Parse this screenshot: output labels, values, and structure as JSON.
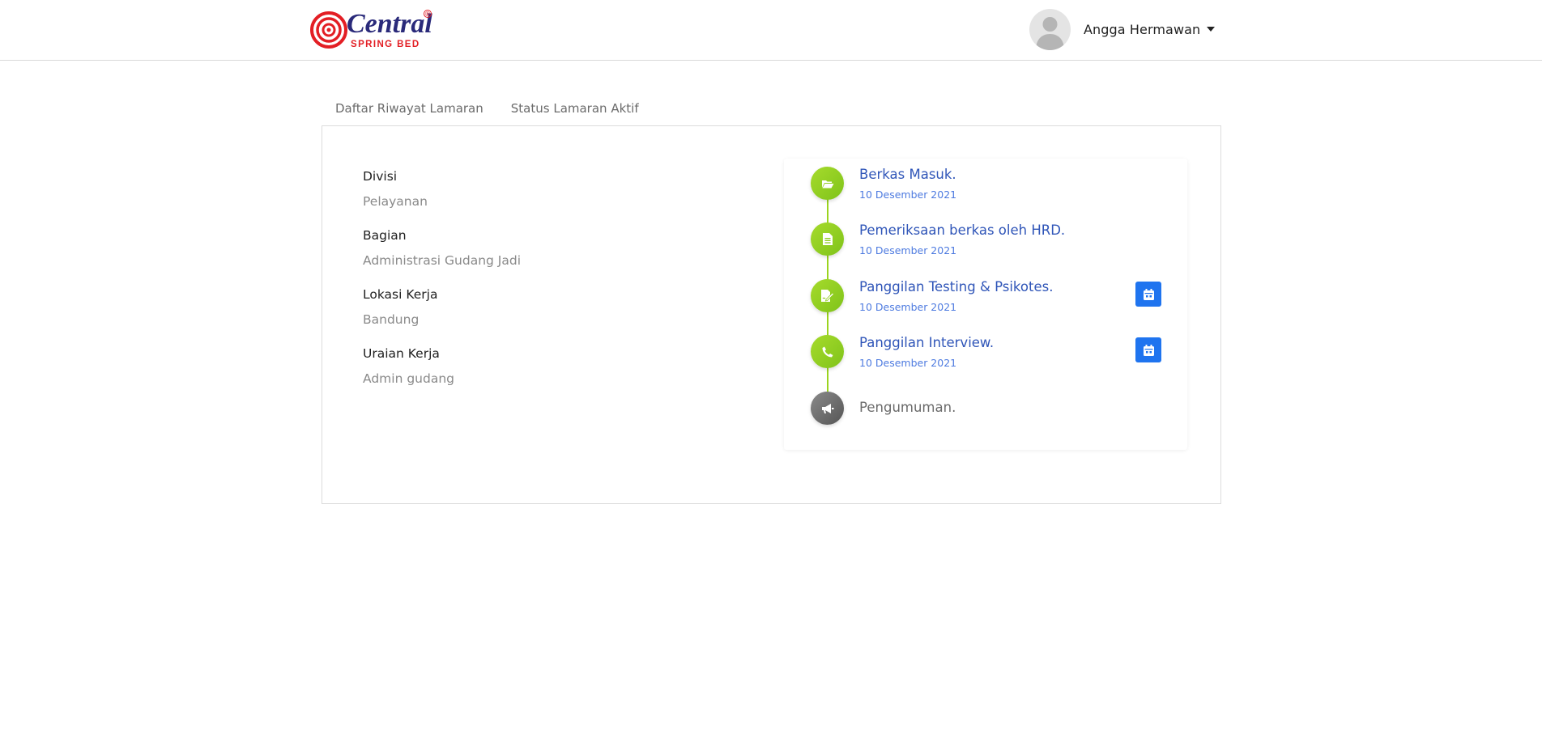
{
  "brand": {
    "logo_text": "Central",
    "logo_subtext": "SPRING BED",
    "logo_mark": "®",
    "logo_colors": {
      "primary": "#2a2a7a",
      "accent": "#e31e24"
    }
  },
  "user": {
    "name": "Angga Hermawan",
    "avatar_icon": "user-silhouette-icon"
  },
  "tabs": [
    {
      "label": "Daftar Riwayat Lamaran"
    },
    {
      "label": "Status Lamaran Aktif"
    }
  ],
  "details": [
    {
      "label": "Divisi",
      "value": "Pelayanan"
    },
    {
      "label": "Bagian",
      "value": "Administrasi Gudang Jadi"
    },
    {
      "label": "Lokasi Kerja",
      "value": "Bandung"
    },
    {
      "label": "Uraian Kerja",
      "value": "Admin gudang"
    }
  ],
  "timeline": [
    {
      "title": "Berkas Masuk.",
      "date": "10 Desember 2021",
      "icon": "folder-open-icon",
      "status": "done"
    },
    {
      "title": "Pemeriksaan berkas oleh HRD.",
      "date": "10 Desember 2021",
      "icon": "document-icon",
      "status": "done"
    },
    {
      "title": "Panggilan Testing & Psikotes.",
      "date": "10 Desember 2021",
      "icon": "signature-icon",
      "status": "done",
      "action_icon": "calendar-icon"
    },
    {
      "title": "Panggilan Interview.",
      "date": "10 Desember 2021",
      "icon": "phone-icon",
      "status": "done",
      "action_icon": "calendar-icon"
    },
    {
      "title": "Pengumuman.",
      "icon": "megaphone-icon",
      "status": "pending"
    }
  ],
  "colors": {
    "done": "#8fcc1f",
    "pending": "#6e6e6e",
    "link": "#2f55b8",
    "button": "#1f74ef"
  }
}
